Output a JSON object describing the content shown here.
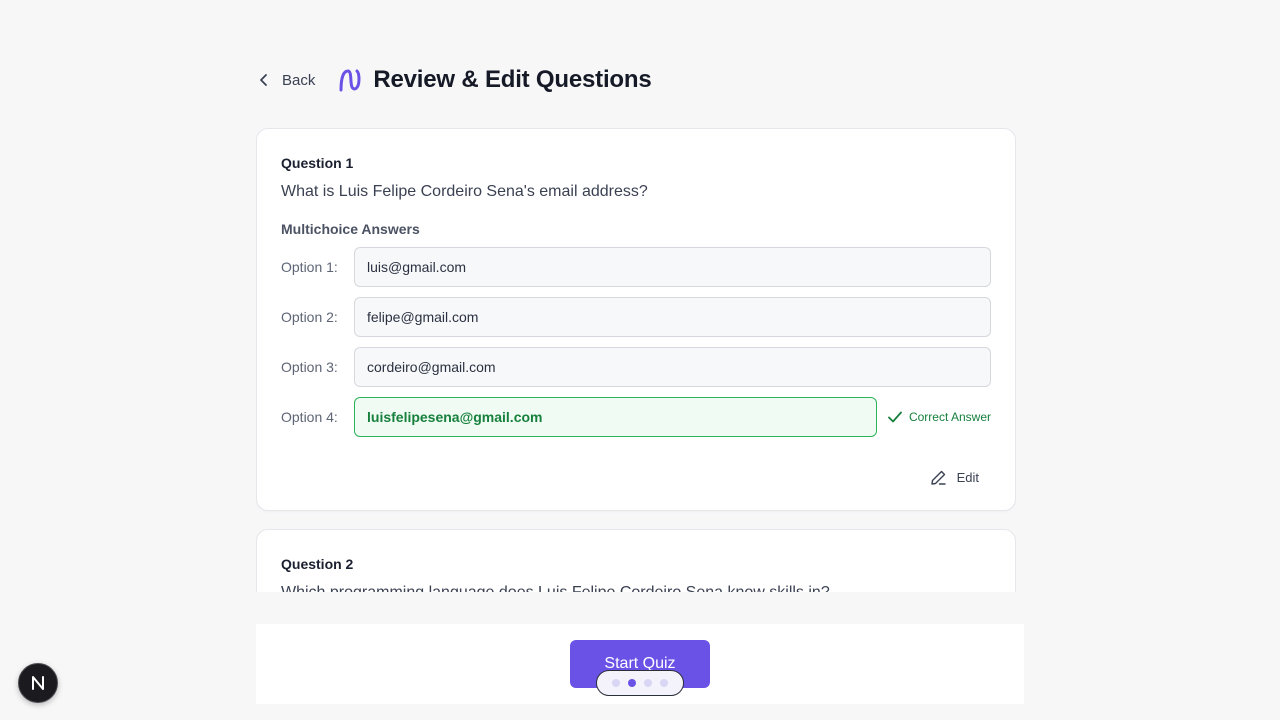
{
  "header": {
    "back_label": "Back",
    "title": "Review & Edit Questions"
  },
  "questions": [
    {
      "label": "Question 1",
      "text": "What is Luis Felipe Cordeiro Sena's email address?",
      "answers_heading": "Multichoice Answers",
      "options": [
        {
          "label": "Option 1:",
          "value": "luis@gmail.com",
          "correct": false
        },
        {
          "label": "Option 2:",
          "value": "felipe@gmail.com",
          "correct": false
        },
        {
          "label": "Option 3:",
          "value": "cordeiro@gmail.com",
          "correct": false
        },
        {
          "label": "Option 4:",
          "value": "luisfelipesena@gmail.com",
          "correct": true
        }
      ],
      "correct_label": "Correct Answer",
      "edit_label": "Edit"
    },
    {
      "label": "Question 2",
      "text": "Which programming language does Luis Felipe Cordeiro Sena know skills in?"
    }
  ],
  "footer": {
    "start_label": "Start Quiz",
    "pagination": {
      "total": 4,
      "active_index": 1
    }
  },
  "colors": {
    "accent": "#6b52e6",
    "correct": "#17803d",
    "correct_bg": "#effbf3"
  },
  "icons": {
    "back": "chevron-left-icon",
    "logo": "brand-logo-icon",
    "correct": "check-icon",
    "edit": "pencil-icon",
    "badge": "n-logo-icon"
  }
}
